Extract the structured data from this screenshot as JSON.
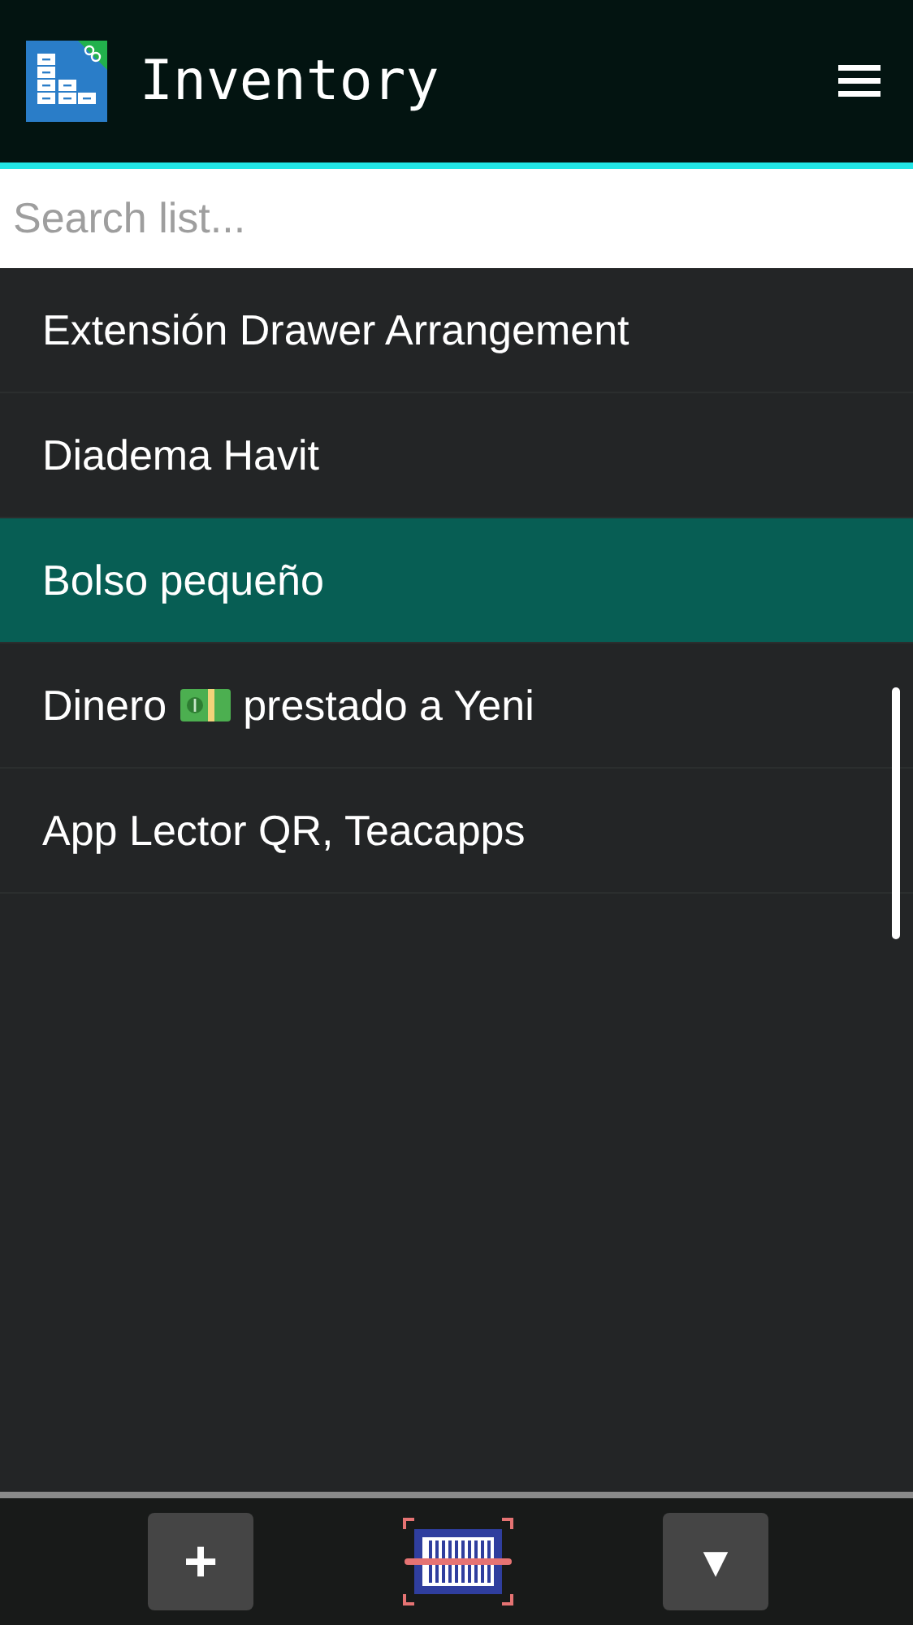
{
  "app_bar": {
    "title": "Inventory"
  },
  "search": {
    "placeholder": "Search list..."
  },
  "items": [
    {
      "kind": "text",
      "label": "Extensión Drawer Arrangement",
      "selected": false
    },
    {
      "kind": "text",
      "label": "Diadema Havit",
      "selected": false
    },
    {
      "kind": "text",
      "label": "Bolso pequeño",
      "selected": true
    },
    {
      "kind": "with_icon",
      "label": "Dinero",
      "label_after": "prestado a Yeni",
      "selected": false
    },
    {
      "kind": "text",
      "label": "App Lector QR, Teacapps",
      "selected": false
    }
  ],
  "bottom_bar": {
    "add": "+",
    "menu": "▼"
  }
}
